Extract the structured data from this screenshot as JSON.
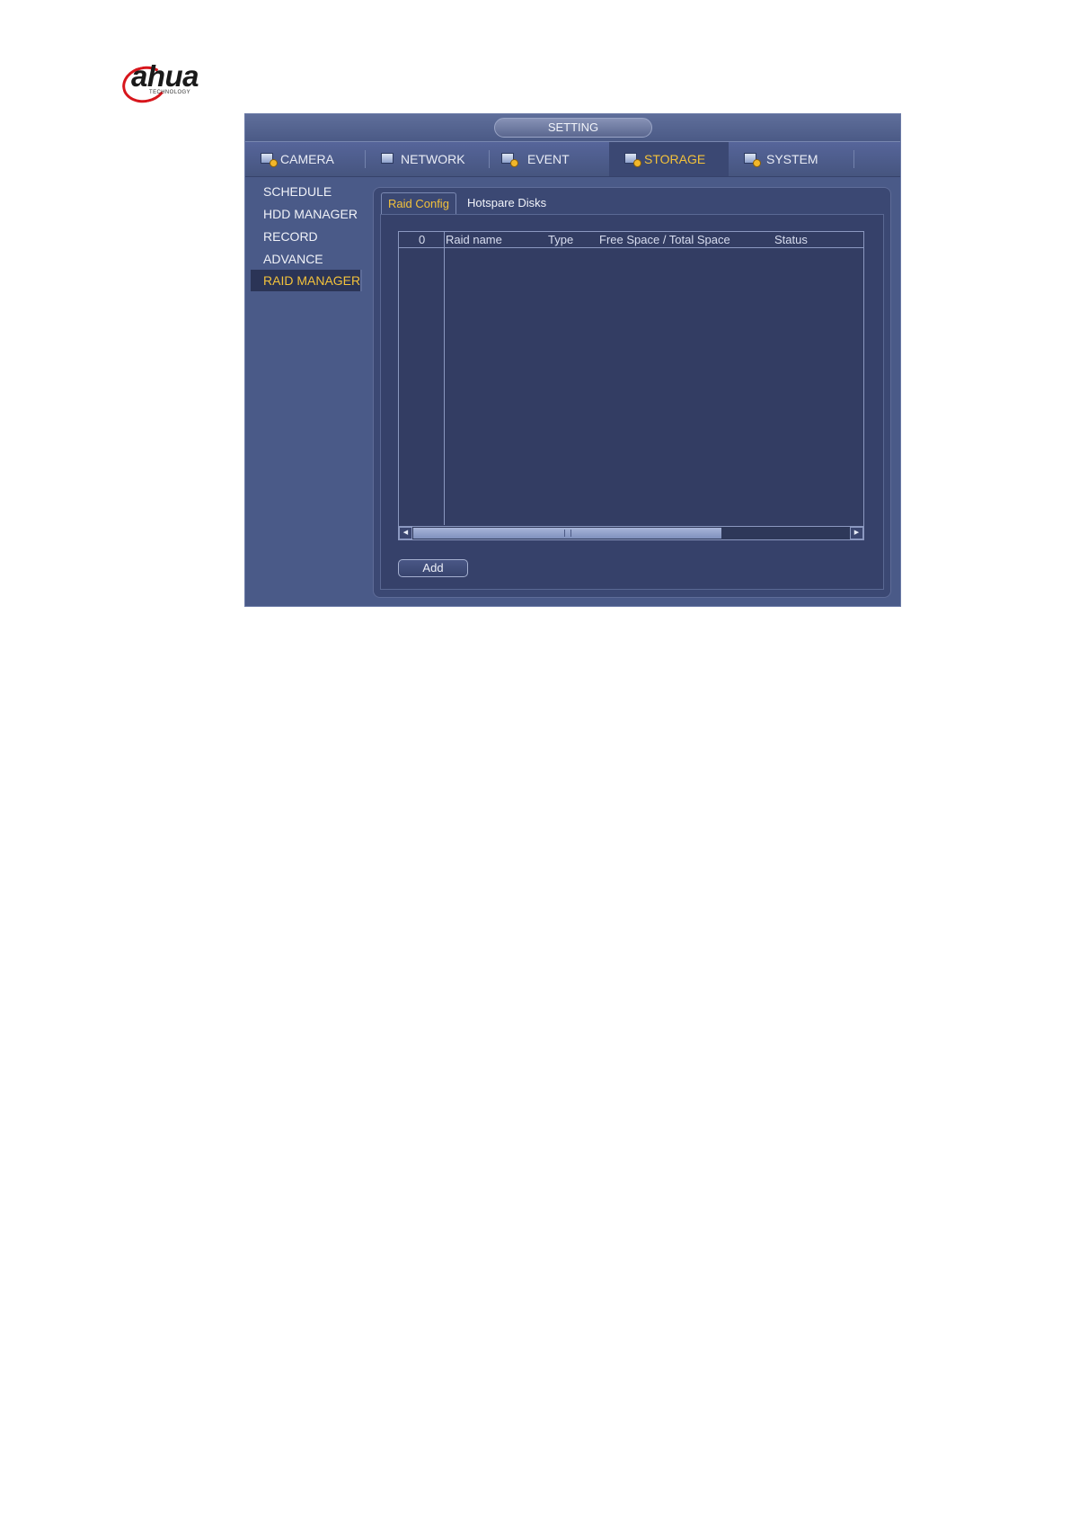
{
  "logo": {
    "brand_a": "a",
    "brand_rest": "hua",
    "tagline": "TECHNOLOGY"
  },
  "window": {
    "title": "SETTING"
  },
  "main_tabs": [
    {
      "label": "CAMERA",
      "icon": "camera-settings-icon",
      "active": false
    },
    {
      "label": "NETWORK",
      "icon": "network-icon",
      "active": false
    },
    {
      "label": "EVENT",
      "icon": "event-icon",
      "active": false
    },
    {
      "label": "STORAGE",
      "icon": "storage-icon",
      "active": true
    },
    {
      "label": "SYSTEM",
      "icon": "system-icon",
      "active": false
    }
  ],
  "sidebar": {
    "items": [
      {
        "label": "SCHEDULE",
        "active": false
      },
      {
        "label": "HDD MANAGER",
        "active": false
      },
      {
        "label": "RECORD",
        "active": false
      },
      {
        "label": "ADVANCE",
        "active": false
      },
      {
        "label": "RAID MANAGER",
        "active": true
      }
    ]
  },
  "sub_tabs": [
    {
      "label": "Raid Config",
      "active": true
    },
    {
      "label": "Hotspare Disks",
      "active": false
    }
  ],
  "table": {
    "columns": [
      "0",
      "Raid name",
      "Type",
      "Free Space / Total Space",
      "Status"
    ],
    "rows": []
  },
  "actions": {
    "add_label": "Add"
  },
  "colors": {
    "accent": "#f3c23b",
    "window_bg": "#4a5a88",
    "panel_bg": "#3b4873",
    "brand_red": "#d7161c"
  }
}
